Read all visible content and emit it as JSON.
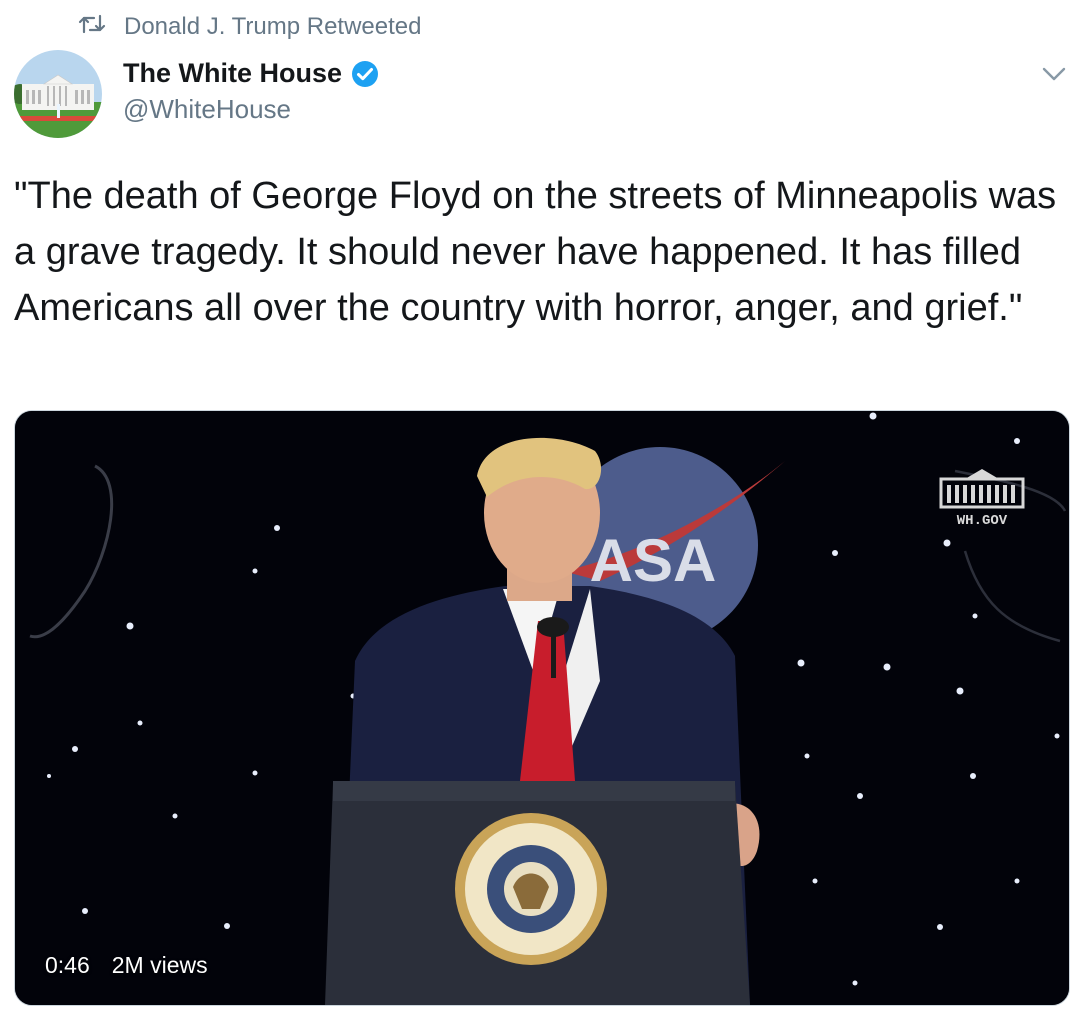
{
  "retweet": {
    "icon": "retweet-icon",
    "label": "Donald J. Trump Retweeted"
  },
  "author": {
    "name": "The White House",
    "handle": "@WhiteHouse",
    "verified": true,
    "verified_color": "#1da1f2",
    "avatar_icon": "white-house-avatar"
  },
  "menu": {
    "icon": "chevron-down-icon"
  },
  "tweet": {
    "text": "\"The death of George Floyd on the streets of Minneapolis was a grave tragedy. It should never have happened. It has filled Americans all over the country with horror, anger, and grief.\""
  },
  "video": {
    "duration": "0:46",
    "views": "2M views",
    "watermark": "WH.GOV",
    "background_logo": "ASA"
  },
  "colors": {
    "text_primary": "#14171a",
    "text_secondary": "#657786",
    "border": "#ccd6dd"
  }
}
